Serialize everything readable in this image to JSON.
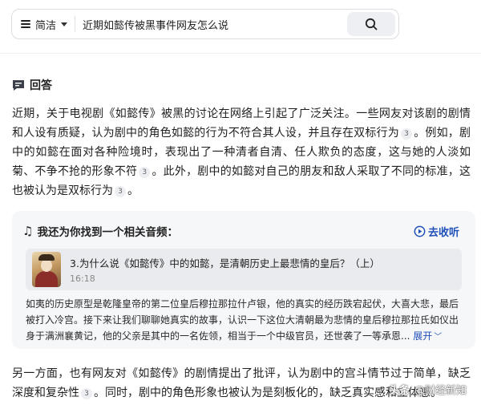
{
  "search": {
    "mode_label": "简洁",
    "query": "近期如懿传被黑事件网友怎么说"
  },
  "answer": {
    "title": "回答",
    "p1": [
      {
        "t": "近期，关于电视剧《如懿传》被黑的讨论在网络上引起了广泛关注。一些网友对该剧的剧情和人设有质疑，认为剧中的角色如懿的行为不符合其人设，并且存在双标行为"
      },
      {
        "c": "3"
      },
      {
        "t": "。例如，剧中的如懿在面对各种险境时，表现出了一种清者自清、任人欺负的态度，这与她的人淡如菊、不争不抢的形象不符"
      },
      {
        "c": "3"
      },
      {
        "t": "。此外，剧中的如懿对自己的朋友和敌人采取了不同的标准，这也被认为是双标行为"
      },
      {
        "c": "3"
      },
      {
        "t": "。"
      }
    ],
    "p2": [
      {
        "t": "另一方面，也有网友对《如懿传》的剧情提出了批评，认为剧中的宫斗情节过于简单，缺乏深度和复杂性"
      },
      {
        "c": "3"
      },
      {
        "t": "。同时，剧中的角色形象也被认为是刻板化的，缺乏真实感和立体感。"
      }
    ]
  },
  "audio": {
    "heading": "我还为你找到一个相关音频：",
    "listen_label": "去收听",
    "track_title": "3.为什么说《如懿传》中的如懿，是清朝历史上最悲情的皇后？（上）",
    "track_duration": "16:18",
    "summary": "如夷的历史原型是乾隆皇帝的第二位皇后穆拉那拉什卢银，他的真实的经历跌宕起伏，大喜大悲，最后被打入冷宫。接下来让我们聊聊她真实的故事，认识一下这位大清朝最为悲情的皇后穆拉那拉氏如仪出身于满洲襄黄记，他的父亲是其中的一名佐领，相当于一个中级官员，还世袭了一等承恩...",
    "expand_label": "展开"
  },
  "watermark": {
    "brand": "头条",
    "account": "@财经新知"
  },
  "colors": {
    "link_blue": "#1f4fb8",
    "card_bg": "#f6f7f9",
    "track_bg": "#eaebee"
  },
  "icons": [
    "menu-icon",
    "caret-down-icon",
    "search-icon",
    "chat-bubble-icon",
    "music-note-icon",
    "play-circle-icon",
    "chevron-down-icon"
  ]
}
